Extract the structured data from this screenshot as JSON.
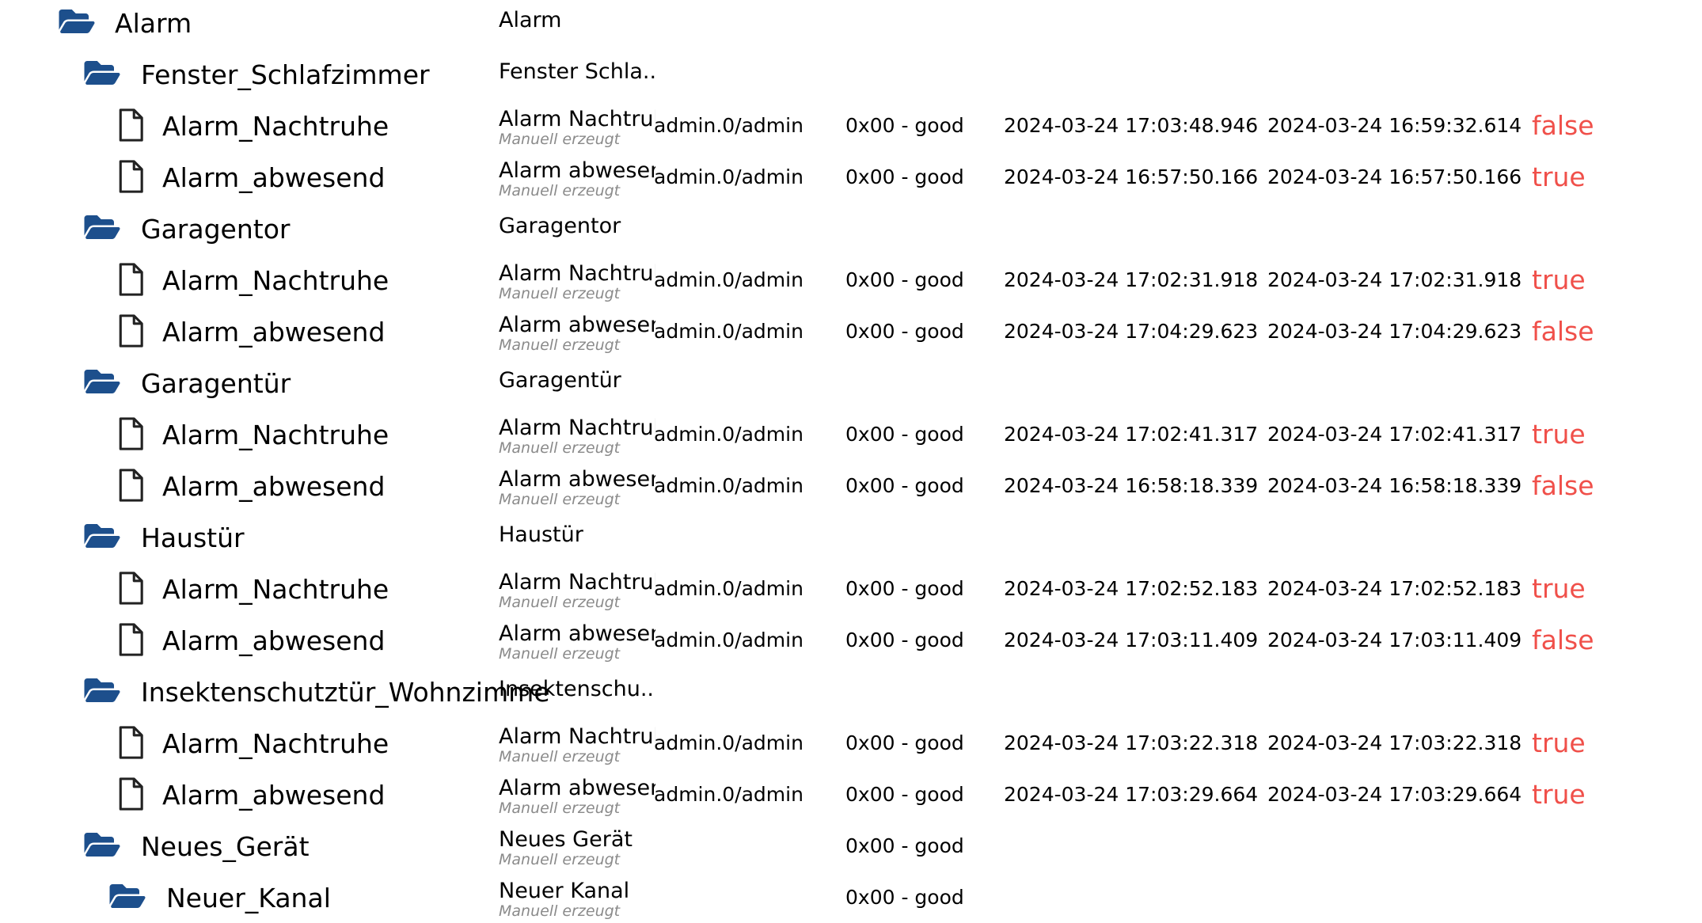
{
  "colors": {
    "folder_icon": "#1d4f8c",
    "value_text": "#f0504a",
    "sub_text": "#8a8a8a"
  },
  "icons": {
    "folder": "folder-open-icon",
    "state": "file-icon"
  },
  "rows": [
    {
      "type": "folder",
      "level": 0,
      "id_label": "Alarm",
      "name": "Alarm",
      "name_sub": "",
      "from": "",
      "quality": "",
      "ts": "",
      "lc": "",
      "value": ""
    },
    {
      "type": "folder",
      "level": 1,
      "id_label": "Fenster_Schlafzimmer",
      "name": "Fenster Schla...",
      "name_sub": "",
      "from": "",
      "quality": "",
      "ts": "",
      "lc": "",
      "value": ""
    },
    {
      "type": "state",
      "level": 2,
      "id_label": "Alarm_Nachtruhe",
      "name": "Alarm Nachtruh",
      "name_sub": "Manuell erzeugt",
      "from": "admin.0/admin",
      "quality": "0x00 - good",
      "ts": "2024-03-24 17:03:48.946",
      "lc": "2024-03-24 16:59:32.614",
      "value": "false"
    },
    {
      "type": "state",
      "level": 2,
      "id_label": "Alarm_abwesend",
      "name": "Alarm abwesen",
      "name_sub": "Manuell erzeugt",
      "from": "admin.0/admin",
      "quality": "0x00 - good",
      "ts": "2024-03-24 16:57:50.166",
      "lc": "2024-03-24 16:57:50.166",
      "value": "true"
    },
    {
      "type": "folder",
      "level": 1,
      "id_label": "Garagentor",
      "name": "Garagentor",
      "name_sub": "",
      "from": "",
      "quality": "",
      "ts": "",
      "lc": "",
      "value": ""
    },
    {
      "type": "state",
      "level": 2,
      "id_label": "Alarm_Nachtruhe",
      "name": "Alarm Nachtruh",
      "name_sub": "Manuell erzeugt",
      "from": "admin.0/admin",
      "quality": "0x00 - good",
      "ts": "2024-03-24 17:02:31.918",
      "lc": "2024-03-24 17:02:31.918",
      "value": "true"
    },
    {
      "type": "state",
      "level": 2,
      "id_label": "Alarm_abwesend",
      "name": "Alarm abwesen",
      "name_sub": "Manuell erzeugt",
      "from": "admin.0/admin",
      "quality": "0x00 - good",
      "ts": "2024-03-24 17:04:29.623",
      "lc": "2024-03-24 17:04:29.623",
      "value": "false"
    },
    {
      "type": "folder",
      "level": 1,
      "id_label": "Garagentür",
      "name": "Garagentür",
      "name_sub": "",
      "from": "",
      "quality": "",
      "ts": "",
      "lc": "",
      "value": ""
    },
    {
      "type": "state",
      "level": 2,
      "id_label": "Alarm_Nachtruhe",
      "name": "Alarm Nachtruh",
      "name_sub": "Manuell erzeugt",
      "from": "admin.0/admin",
      "quality": "0x00 - good",
      "ts": "2024-03-24 17:02:41.317",
      "lc": "2024-03-24 17:02:41.317",
      "value": "true"
    },
    {
      "type": "state",
      "level": 2,
      "id_label": "Alarm_abwesend",
      "name": "Alarm abwesen",
      "name_sub": "Manuell erzeugt",
      "from": "admin.0/admin",
      "quality": "0x00 - good",
      "ts": "2024-03-24 16:58:18.339",
      "lc": "2024-03-24 16:58:18.339",
      "value": "false"
    },
    {
      "type": "folder",
      "level": 1,
      "id_label": "Haustür",
      "name": "Haustür",
      "name_sub": "",
      "from": "",
      "quality": "",
      "ts": "",
      "lc": "",
      "value": ""
    },
    {
      "type": "state",
      "level": 2,
      "id_label": "Alarm_Nachtruhe",
      "name": "Alarm Nachtruh",
      "name_sub": "Manuell erzeugt",
      "from": "admin.0/admin",
      "quality": "0x00 - good",
      "ts": "2024-03-24 17:02:52.183",
      "lc": "2024-03-24 17:02:52.183",
      "value": "true"
    },
    {
      "type": "state",
      "level": 2,
      "id_label": "Alarm_abwesend",
      "name": "Alarm abwesen",
      "name_sub": "Manuell erzeugt",
      "from": "admin.0/admin",
      "quality": "0x00 - good",
      "ts": "2024-03-24 17:03:11.409",
      "lc": "2024-03-24 17:03:11.409",
      "value": "false"
    },
    {
      "type": "folder",
      "level": 1,
      "id_label": "Insektenschutztür_Wohnzimme",
      "name": "Insektenschu...",
      "name_sub": "",
      "from": "",
      "quality": "",
      "ts": "",
      "lc": "",
      "value": ""
    },
    {
      "type": "state",
      "level": 2,
      "id_label": "Alarm_Nachtruhe",
      "name": "Alarm Nachtruh",
      "name_sub": "Manuell erzeugt",
      "from": "admin.0/admin",
      "quality": "0x00 - good",
      "ts": "2024-03-24 17:03:22.318",
      "lc": "2024-03-24 17:03:22.318",
      "value": "true"
    },
    {
      "type": "state",
      "level": 2,
      "id_label": "Alarm_abwesend",
      "name": "Alarm abwesen",
      "name_sub": "Manuell erzeugt",
      "from": "admin.0/admin",
      "quality": "0x00 - good",
      "ts": "2024-03-24 17:03:29.664",
      "lc": "2024-03-24 17:03:29.664",
      "value": "true"
    },
    {
      "type": "folder",
      "level": 1,
      "id_label": "Neues_Gerät",
      "name": "Neues Gerät",
      "name_sub": "Manuell erzeugt",
      "from": "",
      "quality": "0x00 - good",
      "ts": "",
      "lc": "",
      "value": ""
    },
    {
      "type": "folder",
      "level": 2,
      "id_label": "Neuer_Kanal",
      "name": "Neuer Kanal",
      "name_sub": "Manuell erzeugt",
      "from": "",
      "quality": "0x00 - good",
      "ts": "",
      "lc": "",
      "value": ""
    }
  ]
}
